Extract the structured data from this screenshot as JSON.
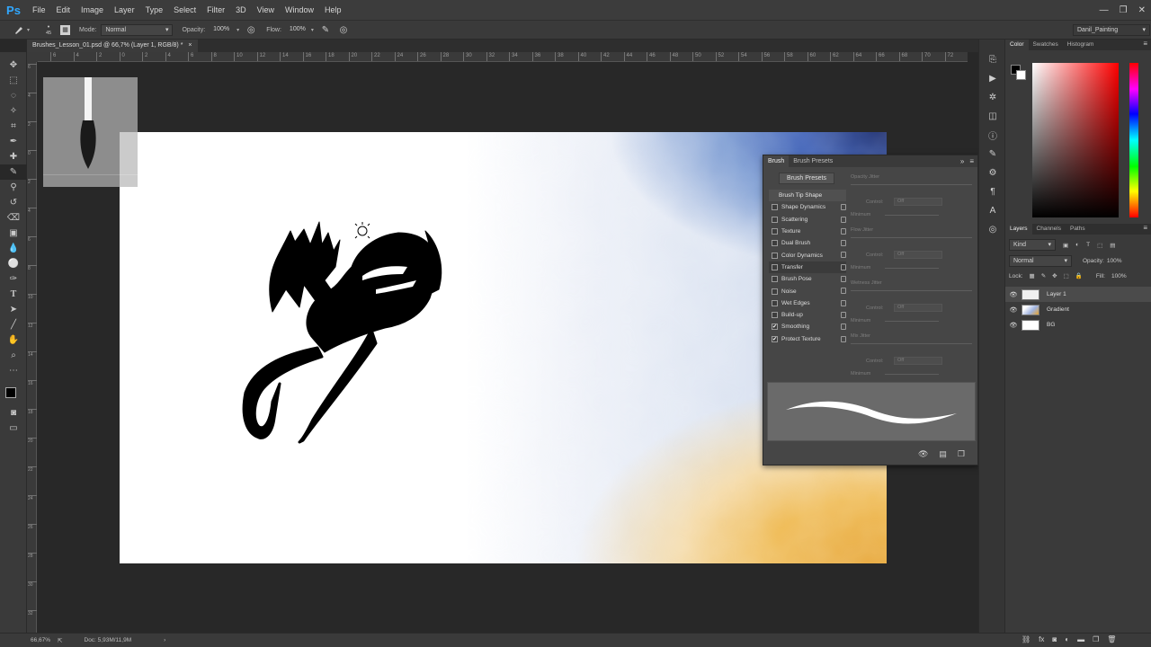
{
  "app": {
    "logo": "Ps"
  },
  "menu": [
    "File",
    "Edit",
    "Image",
    "Layer",
    "Type",
    "Select",
    "Filter",
    "3D",
    "View",
    "Window",
    "Help"
  ],
  "window_controls": [
    "—",
    "❐",
    "✕"
  ],
  "options": {
    "brush_size": "45",
    "mode_label": "Mode:",
    "mode_value": "Normal",
    "opacity_label": "Opacity:",
    "opacity_value": "100%",
    "flow_label": "Flow:",
    "flow_value": "100%",
    "workspace": "Danil_Painting"
  },
  "document": {
    "tab_title": "Brushes_Lesson_01.psd @ 66,7% (Layer 1, RGB/8) *",
    "tab_close": "×"
  },
  "ruler_ticks": [
    "6",
    "4",
    "2",
    "0",
    "2",
    "4",
    "6",
    "8",
    "10",
    "12",
    "14",
    "16",
    "18",
    "20",
    "22",
    "24",
    "26",
    "28",
    "30",
    "32",
    "34",
    "36",
    "38",
    "40",
    "42",
    "44",
    "46",
    "48",
    "50",
    "52",
    "54",
    "56",
    "58",
    "60",
    "62",
    "64",
    "66",
    "68",
    "70",
    "72",
    "74"
  ],
  "ruler_left_ticks": [
    "6",
    "4",
    "2",
    "0",
    "2",
    "4",
    "6",
    "8",
    "10",
    "12",
    "14",
    "16",
    "18",
    "20",
    "22",
    "24",
    "26",
    "28",
    "30",
    "32"
  ],
  "brush_panel": {
    "tabs": [
      "Brush",
      "Brush Presets"
    ],
    "presets_button": "Brush Presets",
    "options": [
      {
        "label": "Brush Tip Shape",
        "checked": null
      },
      {
        "label": "Shape Dynamics",
        "checked": false
      },
      {
        "label": "Scattering",
        "checked": false
      },
      {
        "label": "Texture",
        "checked": false
      },
      {
        "label": "Dual Brush",
        "checked": false
      },
      {
        "label": "Color Dynamics",
        "checked": false
      },
      {
        "label": "Transfer",
        "checked": false
      },
      {
        "label": "Brush Pose",
        "checked": false
      },
      {
        "label": "Noise",
        "checked": false
      },
      {
        "label": "Wet Edges",
        "checked": false
      },
      {
        "label": "Build-up",
        "checked": false
      },
      {
        "label": "Smoothing",
        "checked": true
      },
      {
        "label": "Protect Texture",
        "checked": true
      }
    ],
    "settings": {
      "opacity_jitter": "Opacity Jitter",
      "control": "Control:",
      "off": "Off",
      "minimum": "Minimum",
      "flow_jitter": "Flow Jitter",
      "wetness_jitter": "Wetness Jitter",
      "mix_jitter": "Mix Jitter"
    }
  },
  "color_panel": {
    "tabs": [
      "Color",
      "Swatches",
      "Histogram"
    ]
  },
  "layers_panel": {
    "tabs": [
      "Layers",
      "Channels",
      "Paths"
    ],
    "filter_kind": "Kind",
    "blend_mode": "Normal",
    "opacity_label": "Opacity:",
    "opacity_value": "100%",
    "lock_label": "Lock:",
    "fill_label": "Fill:",
    "fill_value": "100%",
    "layers": [
      {
        "name": "Layer 1",
        "selected": true
      },
      {
        "name": "Gradient",
        "selected": false
      },
      {
        "name": "BG",
        "selected": false
      }
    ]
  },
  "status": {
    "zoom": "66,67%",
    "doc": "Doc: 5,93M/11,9M",
    "arrow": "›"
  },
  "colors": {
    "ui_bg": "#282828",
    "panel": "#3a3a3a",
    "ps_blue": "#31a8ff",
    "gradient_blue": "#1c2d6e",
    "gradient_orange": "#e6a32f",
    "stroke": "#000000"
  }
}
